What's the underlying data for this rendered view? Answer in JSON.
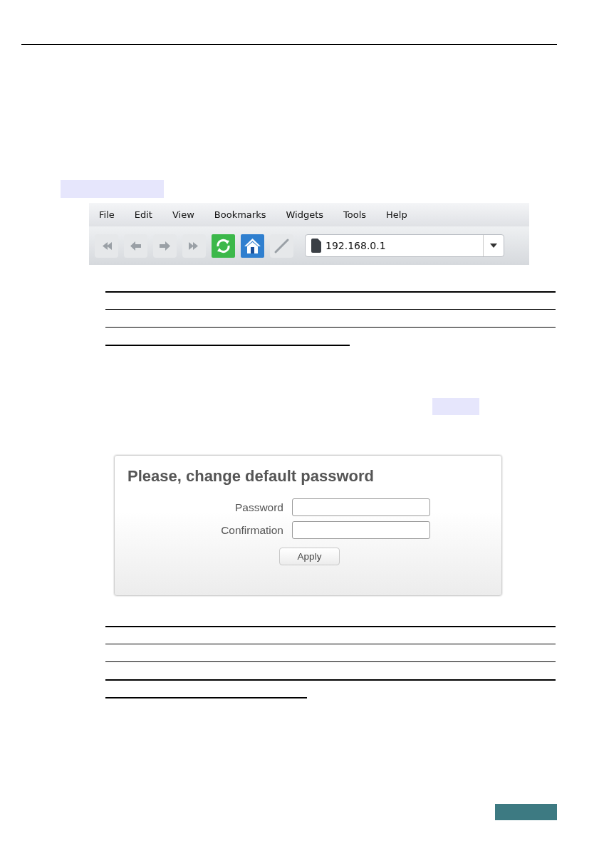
{
  "browser": {
    "menu": [
      "File",
      "Edit",
      "View",
      "Bookmarks",
      "Widgets",
      "Tools",
      "Help"
    ],
    "address": "192.168.0.1"
  },
  "dialog": {
    "title": "Please, change default password",
    "fields": [
      {
        "label": "Password"
      },
      {
        "label": "Confirmation"
      }
    ],
    "button": "Apply"
  }
}
